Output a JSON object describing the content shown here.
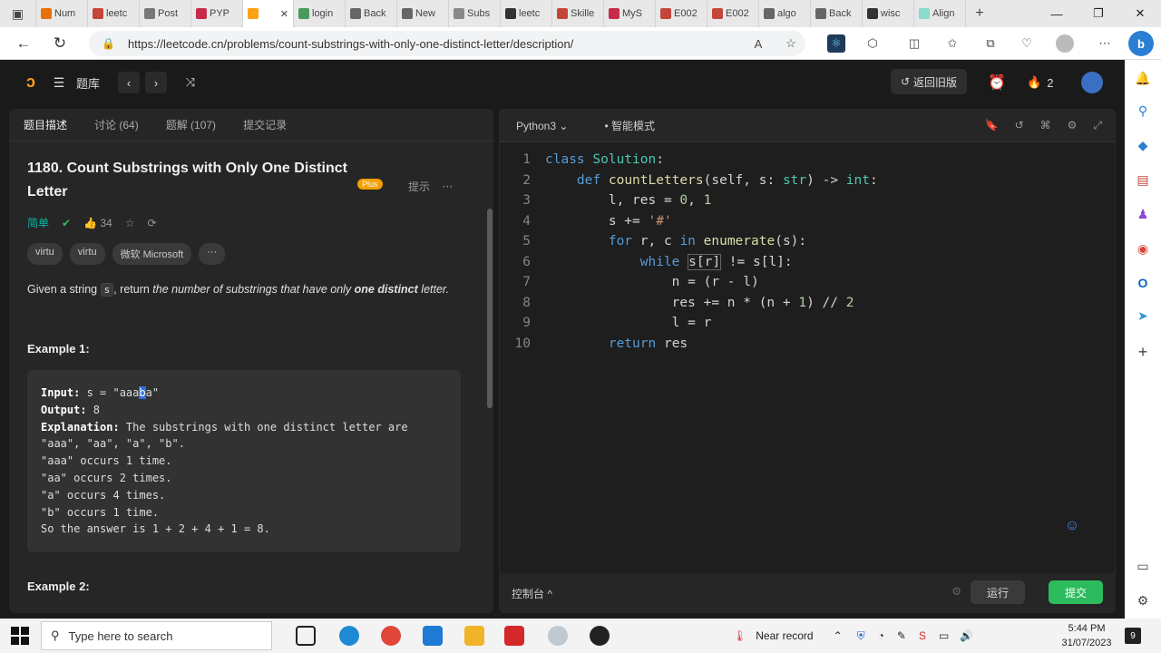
{
  "browser": {
    "tabs": [
      {
        "label": "Num",
        "color": "#e8710a"
      },
      {
        "label": "leetc",
        "color": "#c4463a"
      },
      {
        "label": "Post",
        "color": "#777"
      },
      {
        "label": "PYP",
        "color": "#c82a4a"
      },
      {
        "label": "",
        "color": "#ffa116",
        "active": true
      },
      {
        "label": "login",
        "color": "#4a9a5a"
      },
      {
        "label": "Back",
        "color": "#666"
      },
      {
        "label": "New",
        "color": "#666"
      },
      {
        "label": "Subs",
        "color": "#888"
      },
      {
        "label": "leetc",
        "color": "#333"
      },
      {
        "label": "Skille",
        "color": "#c4463a"
      },
      {
        "label": "MyS",
        "color": "#c82a4a"
      },
      {
        "label": "E002",
        "color": "#c4463a"
      },
      {
        "label": "E002",
        "color": "#c4463a"
      },
      {
        "label": "algo",
        "color": "#666"
      },
      {
        "label": "Back",
        "color": "#666"
      },
      {
        "label": "wisc",
        "color": "#333"
      },
      {
        "label": "Align",
        "color": "#8dc"
      }
    ],
    "url": "https://leetcode.cn/problems/count-substrings-with-only-one-distinct-letter/description/"
  },
  "header": {
    "problem_bank": "题库",
    "back_old": "返回旧版",
    "streak": "2"
  },
  "left_tabs": [
    "题目描述",
    "讨论 (64)",
    "题解 (107)",
    "提交记录"
  ],
  "problem": {
    "title": "1180. Count Substrings with Only One Distinct Letter",
    "plus": "Plus",
    "hint": "提示",
    "difficulty": "简单",
    "likes": "34",
    "tags": [
      "virtu",
      "virtu",
      "微软 Microsoft",
      "···"
    ],
    "desc_pre": "Given a string ",
    "desc_code": "s",
    "desc_mid": ", return ",
    "desc_em": "the number of substrings that have only ",
    "desc_strong": "one distinct",
    "desc_post": " letter.",
    "example1_title": "Example 1:",
    "example2_title": "Example 2:",
    "example1": {
      "input_label": "Input:",
      "input_pre": " s = \"aaa",
      "input_hl": "b",
      "input_post": "a\"",
      "output_label": "Output:",
      "output_value": " 8",
      "explanation_label": "Explanation:",
      "explanation_value": " The substrings with one distinct letter are",
      "lines": [
        "\"aaa\", \"aa\", \"a\", \"b\".",
        "\"aaa\" occurs 1 time.",
        "\"aa\" occurs 2 times.",
        "\"a\" occurs 4 times.",
        "\"b\" occurs 1 time.",
        "So the answer is 1 + 2 + 4 + 1 = 8."
      ]
    }
  },
  "editor": {
    "language": "Python3",
    "mode": "智能模式",
    "line_numbers": [
      "1",
      "2",
      "3",
      "4",
      "5",
      "6",
      "7",
      "8",
      "9",
      "10"
    ]
  },
  "console": {
    "label": "控制台 ^",
    "run": "运行",
    "submit": "提交"
  },
  "taskbar": {
    "search_placeholder": "Type here to search",
    "weather": "Near record",
    "time": "5:44 PM",
    "date": "31/07/2023"
  }
}
